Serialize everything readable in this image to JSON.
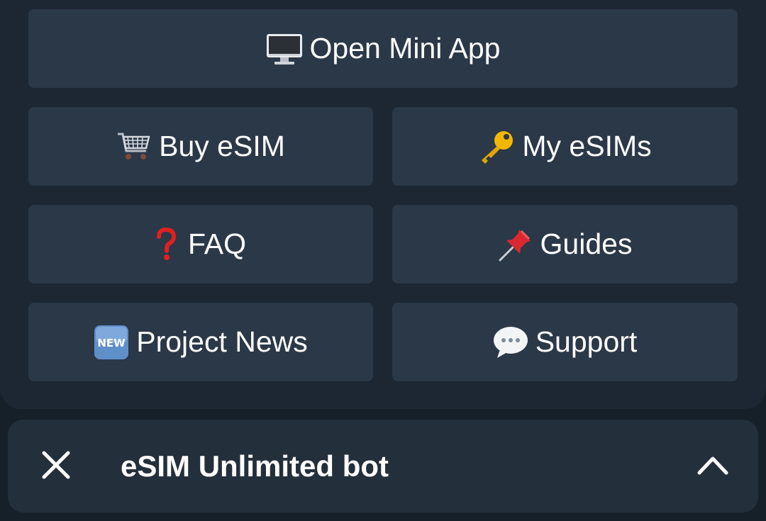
{
  "keyboard": {
    "open_mini_app": "Open Mini App",
    "buy_esim": "Buy eSIM",
    "my_esims": "My eSIMs",
    "faq": "FAQ",
    "guides": "Guides",
    "project_news": "Project News",
    "support": "Support"
  },
  "bot_bar": {
    "title": "eSIM Unlimited bot"
  },
  "icons": {
    "open_mini_app": "desktop-computer-icon",
    "buy_esim": "shopping-cart-icon",
    "my_esims": "key-icon",
    "faq": "red-question-mark-icon",
    "guides": "pushpin-icon",
    "project_news": "new-button-icon",
    "support": "speech-balloon-icon",
    "close": "close-icon",
    "expand": "chevron-up-icon"
  },
  "colors": {
    "button_bg": "#2b3848",
    "panel_bg": "#1d2733",
    "bar_bg": "#242f3c",
    "text": "#ffffff"
  }
}
